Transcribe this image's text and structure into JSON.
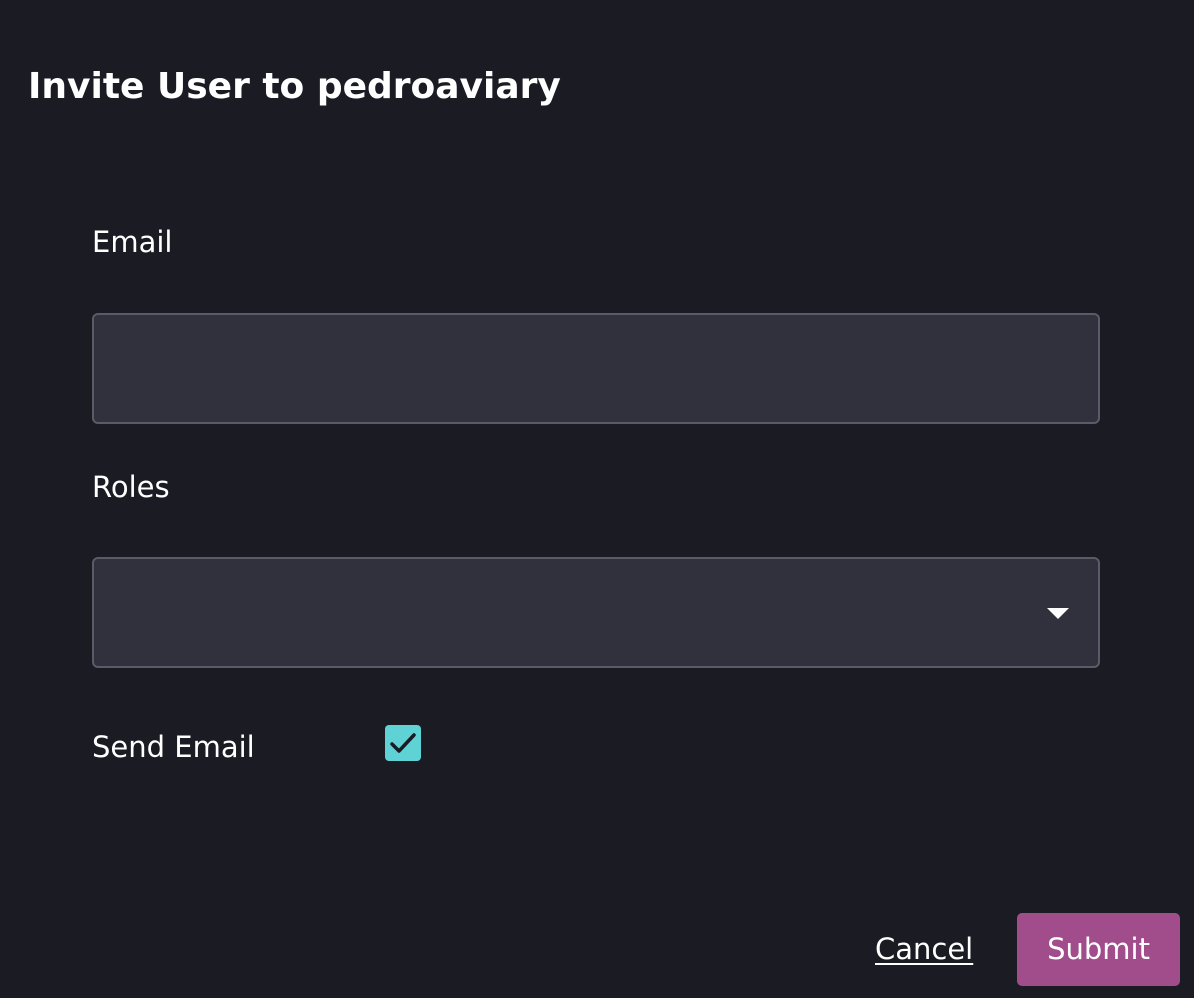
{
  "dialog": {
    "title": "Invite User to pedroaviary"
  },
  "form": {
    "email": {
      "label": "Email",
      "value": "",
      "placeholder": ""
    },
    "roles": {
      "label": "Roles",
      "selected": "",
      "icon": "caret-down-icon"
    },
    "send_email": {
      "label": "Send Email",
      "checked": true,
      "icon": "checkmark-icon",
      "color": "#5fd2d5"
    }
  },
  "actions": {
    "cancel_label": "Cancel",
    "submit_label": "Submit",
    "submit_color": "#a14d8c"
  },
  "theme": {
    "background": "#1b1b24",
    "input_background": "#31303d",
    "input_border": "#5b5a66",
    "text": "#ffffff"
  }
}
